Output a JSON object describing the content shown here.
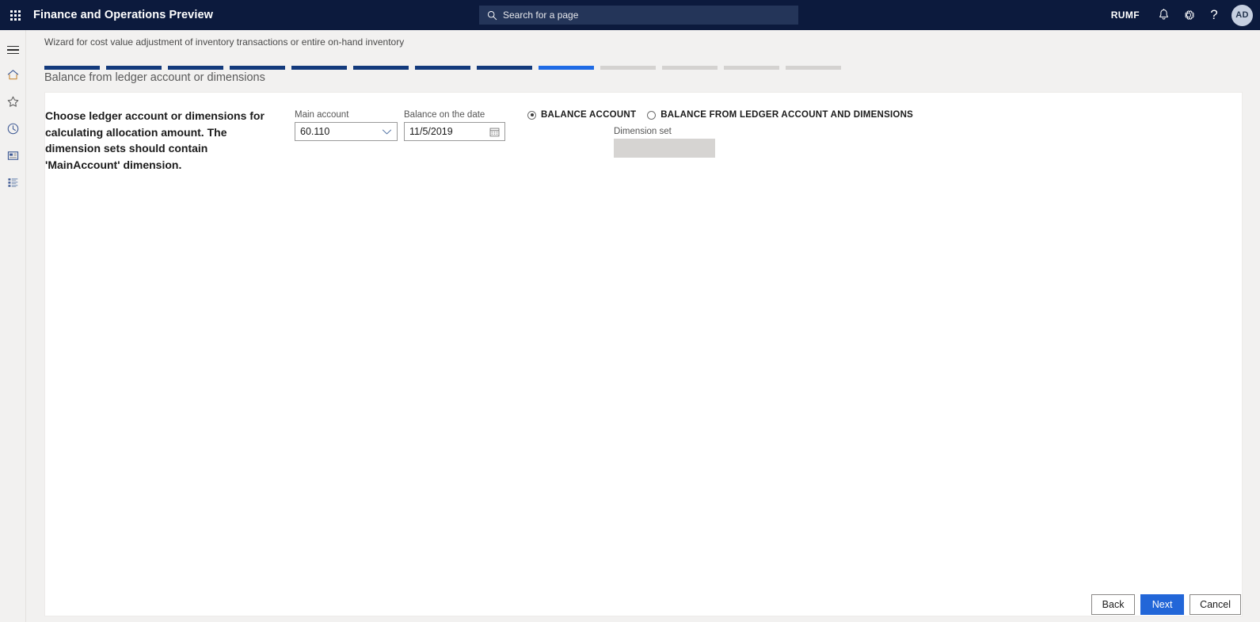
{
  "topbar": {
    "waffle_icon": "app-launcher-icon",
    "title": "Finance and Operations Preview",
    "search": {
      "icon": "search-icon",
      "placeholder": "Search for a page",
      "value": ""
    },
    "company": "RUMF",
    "icons": {
      "notifications": "bell-icon",
      "settings": "gear-icon",
      "help": "question-mark-icon"
    },
    "avatar_initials": "AD"
  },
  "rail": {
    "items": [
      {
        "name": "menu-icon",
        "label": "Expand the navigation pane"
      },
      {
        "name": "home-icon",
        "label": "Home"
      },
      {
        "name": "star-icon",
        "label": "Favorites"
      },
      {
        "name": "clock-icon",
        "label": "Recent"
      },
      {
        "name": "workspace-icon",
        "label": "Workspaces"
      },
      {
        "name": "modules-icon",
        "label": "Modules"
      }
    ]
  },
  "wizard": {
    "caption": "Wizard for cost value adjustment of inventory transactions or entire on-hand inventory",
    "step_title": "Balance from ledger account or dimensions",
    "progress": {
      "total_steps": 13,
      "current_step": 9,
      "segments": [
        "done",
        "done",
        "done",
        "done",
        "done",
        "done",
        "done",
        "done",
        "active",
        "todo",
        "todo",
        "todo",
        "todo"
      ],
      "colors": {
        "done": "#133a7c",
        "active": "#1f6be5",
        "todo": "#d4d2d0"
      }
    }
  },
  "form": {
    "instruction": "Choose ledger account or dimensions for calculating allocation amount. The dimension sets should contain 'MainAccount' dimension.",
    "main_account": {
      "label": "Main account",
      "value": "60.110",
      "icon": "chevron-down-icon"
    },
    "balance_date": {
      "label": "Balance on the date",
      "value": "11/5/2019",
      "icon": "calendar-icon"
    },
    "radio_options": [
      {
        "label": "Balance account",
        "selected": true
      },
      {
        "label": "Balance from ledger account and dimensions",
        "selected": false
      }
    ],
    "dimension_set": {
      "label": "Dimension set",
      "value": "",
      "disabled": true
    }
  },
  "footer": {
    "back": "Back",
    "next": "Next",
    "cancel": "Cancel"
  },
  "theme": {
    "header_bg": "#0c1a3d",
    "search_bg": "#243559",
    "page_bg": "#f2f1f0",
    "panel_bg": "#ffffff",
    "primary": "#2266d8"
  }
}
